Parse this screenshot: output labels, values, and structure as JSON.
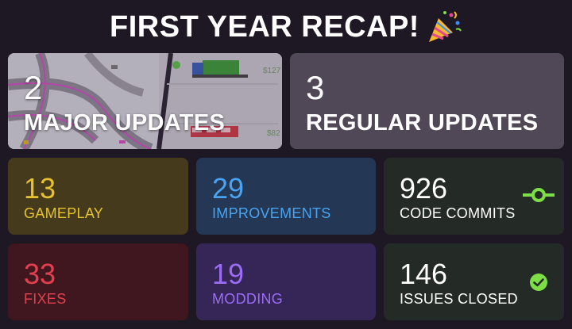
{
  "header": {
    "title": "FIRST YEAR RECAP!",
    "icon": "party-popper-icon"
  },
  "cards": {
    "major": {
      "value": "2",
      "label": "MAJOR UPDATES"
    },
    "regular": {
      "value": "3",
      "label": "REGULAR UPDATES"
    },
    "gameplay": {
      "value": "13",
      "label": "GAMEPLAY",
      "color": "#e7c12e"
    },
    "improvements": {
      "value": "29",
      "label": "IMPROVEMENTS",
      "color": "#4aa3f0"
    },
    "commits": {
      "value": "926",
      "label": "CODE COMMITS",
      "color": "#ffffff",
      "icon": "git-commit-icon",
      "icon_color": "#7ddf45"
    },
    "fixes": {
      "value": "33",
      "label": "FIXES",
      "color": "#e3404f"
    },
    "modding": {
      "value": "19",
      "label": "MODDING",
      "color": "#9b6df5"
    },
    "issues": {
      "value": "146",
      "label": "ISSUES CLOSED",
      "color": "#ffffff",
      "icon": "check-circle-icon",
      "icon_color": "#7ddf45"
    }
  },
  "screenshot_text": {
    "price_1": "$127",
    "price_2": "$82"
  }
}
